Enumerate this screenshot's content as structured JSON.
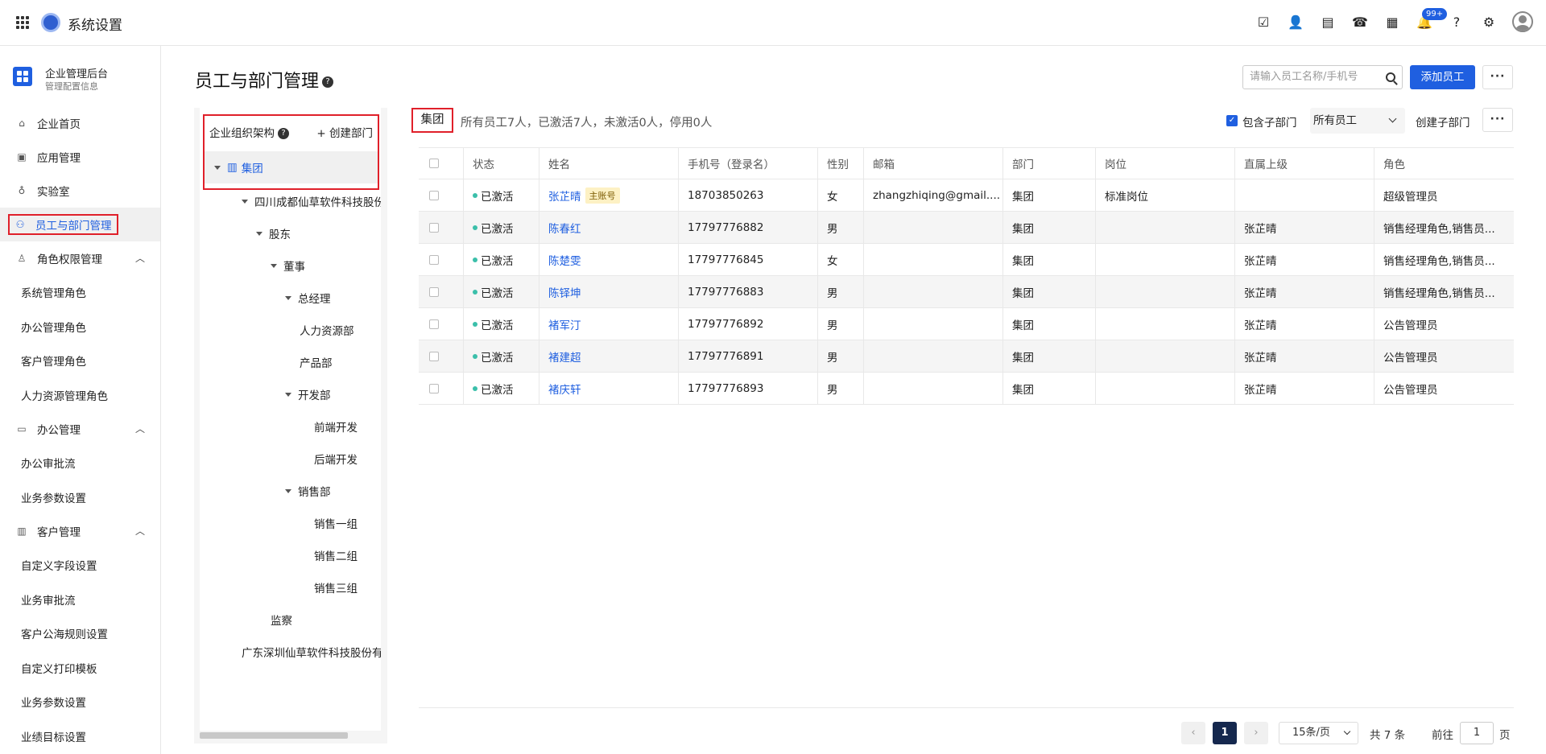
{
  "app": {
    "title": "系统设置"
  },
  "topbar": {
    "icons": [
      "task-icon",
      "contacts-icon",
      "document-icon",
      "phone-icon",
      "calendar-icon",
      "bell-icon",
      "help-icon",
      "settings-icon",
      "user-avatar-icon"
    ],
    "notification_badge": "99+"
  },
  "sidebar": {
    "brand_title": "企业管理后台",
    "brand_subtitle": "管理配置信息",
    "items": [
      {
        "label": "企业首页",
        "icon": "home-icon"
      },
      {
        "label": "应用管理",
        "icon": "apps-icon"
      },
      {
        "label": "实验室",
        "icon": "bulb-icon"
      },
      {
        "label": "员工与部门管理",
        "icon": "users-icon",
        "active": true
      }
    ],
    "groups": [
      {
        "label": "角色权限管理",
        "icon": "role-icon",
        "children": [
          "系统管理角色",
          "办公管理角色",
          "客户管理角色",
          "人力资源管理角色"
        ]
      },
      {
        "label": "办公管理",
        "icon": "briefcase-icon",
        "children": [
          "办公审批流",
          "业务参数设置"
        ]
      },
      {
        "label": "客户管理",
        "icon": "customer-icon",
        "children": [
          "自定义字段设置",
          "业务审批流",
          "客户公海规则设置",
          "自定义打印模板",
          "业务参数设置",
          "业绩目标设置"
        ]
      }
    ]
  },
  "page": {
    "title": "员工与部门管理",
    "search_placeholder": "请输入员工名称/手机号",
    "add_employee": "添加员工",
    "more": "···"
  },
  "tree": {
    "title": "企业组织架构",
    "create_dept": "+ 创建部门",
    "root": "集团",
    "nodes": [
      {
        "label": "四川成都仙草软件科技股份有限公司",
        "level": 1,
        "expanded": true
      },
      {
        "label": "股东",
        "level": 2,
        "expanded": true
      },
      {
        "label": "董事",
        "level": 3,
        "expanded": true
      },
      {
        "label": "总经理",
        "level": 4,
        "expanded": true
      },
      {
        "label": "人力资源部",
        "level": 5
      },
      {
        "label": "产品部",
        "level": 5
      },
      {
        "label": "开发部",
        "level": 5,
        "expanded": true
      },
      {
        "label": "前端开发",
        "level": 6
      },
      {
        "label": "后端开发",
        "level": 6
      },
      {
        "label": "销售部",
        "level": 5,
        "expanded": true
      },
      {
        "label": "销售一组",
        "level": 6
      },
      {
        "label": "销售二组",
        "level": 6
      },
      {
        "label": "销售三组",
        "level": 6
      },
      {
        "label": "监察",
        "level": 3
      },
      {
        "label": "广东深圳仙草软件科技股份有限公司",
        "level": 1
      }
    ]
  },
  "content": {
    "group_tag": "集团",
    "summary": "所有员工7人，已激活7人，未激活0人，停用0人",
    "include_sub": "包含子部门",
    "filter_value": "所有员工",
    "create_sub": "创建子部门",
    "more": "···"
  },
  "table": {
    "columns": [
      "状态",
      "姓名",
      "手机号（登录名）",
      "性别",
      "邮箱",
      "部门",
      "岗位",
      "直属上级",
      "角色"
    ],
    "rows": [
      {
        "status": "已激活",
        "name": "张芷晴",
        "tag": "主账号",
        "phone": "18703850263",
        "gender": "女",
        "email": "zhangzhiqing@gmail....",
        "dept": "集团",
        "post": "标准岗位",
        "manager": "",
        "role": "超级管理员"
      },
      {
        "status": "已激活",
        "name": "陈春红",
        "tag": "",
        "phone": "17797776882",
        "gender": "男",
        "email": "",
        "dept": "集团",
        "post": "",
        "manager": "张芷晴",
        "role": "销售经理角色,销售员..."
      },
      {
        "status": "已激活",
        "name": "陈楚雯",
        "tag": "",
        "phone": "17797776845",
        "gender": "女",
        "email": "",
        "dept": "集团",
        "post": "",
        "manager": "张芷晴",
        "role": "销售经理角色,销售员..."
      },
      {
        "status": "已激活",
        "name": "陈铎坤",
        "tag": "",
        "phone": "17797776883",
        "gender": "男",
        "email": "",
        "dept": "集团",
        "post": "",
        "manager": "张芷晴",
        "role": "销售经理角色,销售员..."
      },
      {
        "status": "已激活",
        "name": "褚军汀",
        "tag": "",
        "phone": "17797776892",
        "gender": "男",
        "email": "",
        "dept": "集团",
        "post": "",
        "manager": "张芷晴",
        "role": "公告管理员"
      },
      {
        "status": "已激活",
        "name": "褚建超",
        "tag": "",
        "phone": "17797776891",
        "gender": "男",
        "email": "",
        "dept": "集团",
        "post": "",
        "manager": "张芷晴",
        "role": "公告管理员"
      },
      {
        "status": "已激活",
        "name": "褚庆轩",
        "tag": "",
        "phone": "17797776893",
        "gender": "男",
        "email": "",
        "dept": "集团",
        "post": "",
        "manager": "张芷晴",
        "role": "公告管理员"
      }
    ]
  },
  "pagination": {
    "current": "1",
    "page_size": "15条/页",
    "total": "共 7 条",
    "goto_label": "前往",
    "goto_value": "1",
    "goto_unit": "页"
  },
  "colors": {
    "primary": "#1f5fe0",
    "highlight": "#e0202a",
    "active_dot": "#3bbfaa"
  }
}
